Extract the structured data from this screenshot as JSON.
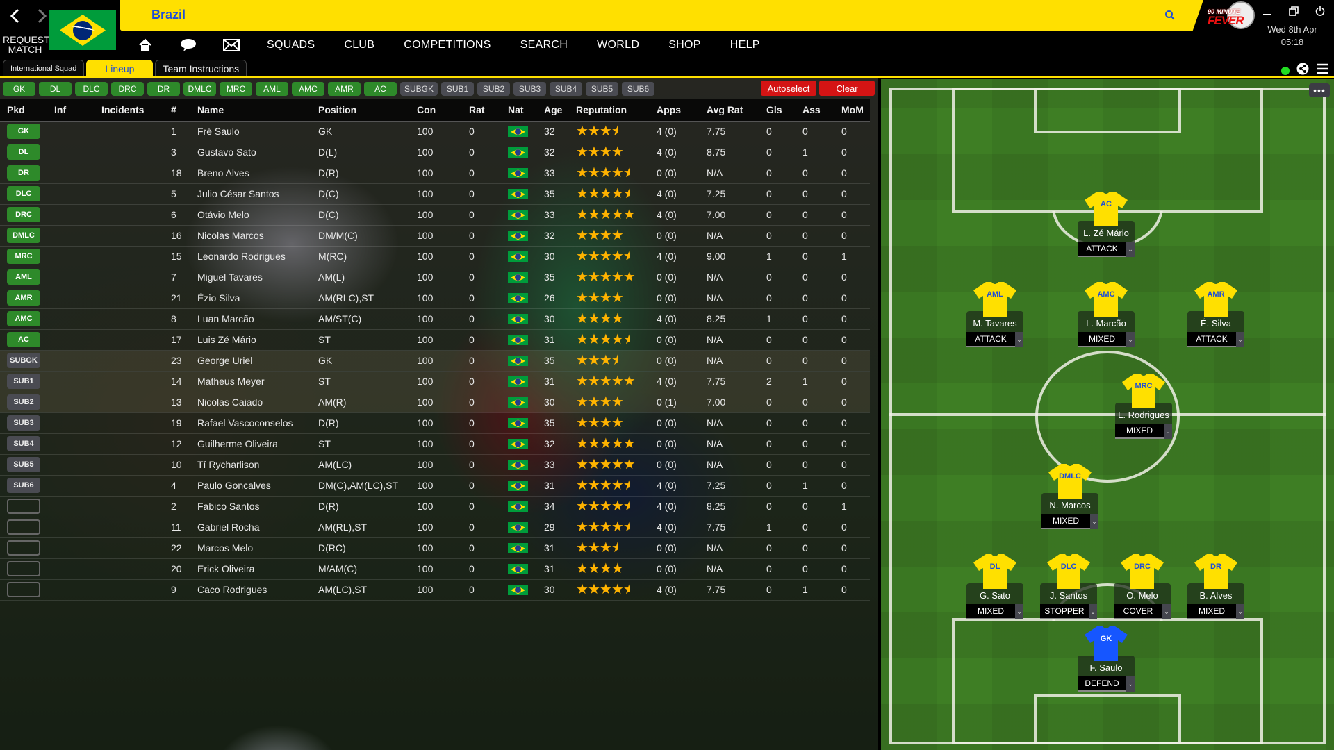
{
  "header": {
    "title": "Brazil",
    "request_match": "REQUEST MATCH",
    "date": "Wed 8th Apr",
    "time": "05:18",
    "logo_top": "90 MINUTE",
    "logo_bottom": "FEVER"
  },
  "menu": [
    "SQUADS",
    "CLUB",
    "COMPETITIONS",
    "SEARCH",
    "WORLD",
    "SHOP",
    "HELP"
  ],
  "tabs": [
    "International Squad",
    "Lineup",
    "Team Instructions"
  ],
  "active_tab": "Lineup",
  "position_buttons": [
    "GK",
    "DL",
    "DLC",
    "DRC",
    "DR",
    "DMLC",
    "MRC",
    "AML",
    "AMC",
    "AMR",
    "AC"
  ],
  "sub_buttons": [
    "SUBGK",
    "SUB1",
    "SUB2",
    "SUB3",
    "SUB4",
    "SUB5",
    "SUB6"
  ],
  "actions": {
    "autoselect": "Autoselect",
    "clear": "Clear"
  },
  "columns": [
    "Pkd",
    "Inf",
    "Incidents",
    "#",
    "Name",
    "Position",
    "Con",
    "Rat",
    "Nat",
    "Age",
    "Reputation",
    "Apps",
    "Avg Rat",
    "Gls",
    "Ass",
    "MoM"
  ],
  "players": [
    {
      "pkd": "GK",
      "num": "1",
      "name": "Fré Saulo",
      "pos": "GK",
      "con": "100",
      "rat": "0",
      "age": "32",
      "rep": 3.5,
      "apps": "4 (0)",
      "avg": "7.75",
      "gls": "0",
      "ass": "0",
      "mom": "0"
    },
    {
      "pkd": "DL",
      "num": "3",
      "name": "Gustavo Sato",
      "pos": "D(L)",
      "con": "100",
      "rat": "0",
      "age": "32",
      "rep": 4,
      "apps": "4 (0)",
      "avg": "8.75",
      "gls": "0",
      "ass": "1",
      "mom": "0"
    },
    {
      "pkd": "DR",
      "num": "18",
      "name": "Breno Alves",
      "pos": "D(R)",
      "con": "100",
      "rat": "0",
      "age": "33",
      "rep": 4.5,
      "apps": "0 (0)",
      "avg": "N/A",
      "gls": "0",
      "ass": "0",
      "mom": "0"
    },
    {
      "pkd": "DLC",
      "num": "5",
      "name": "Julio César Santos",
      "pos": "D(C)",
      "con": "100",
      "rat": "0",
      "age": "35",
      "rep": 4.5,
      "apps": "4 (0)",
      "avg": "7.25",
      "gls": "0",
      "ass": "0",
      "mom": "0"
    },
    {
      "pkd": "DRC",
      "num": "6",
      "name": "Otávio Melo",
      "pos": "D(C)",
      "con": "100",
      "rat": "0",
      "age": "33",
      "rep": 5,
      "apps": "4 (0)",
      "avg": "7.00",
      "gls": "0",
      "ass": "0",
      "mom": "0"
    },
    {
      "pkd": "DMLC",
      "num": "16",
      "name": "Nicolas Marcos",
      "pos": "DM/M(C)",
      "con": "100",
      "rat": "0",
      "age": "32",
      "rep": 4,
      "apps": "0 (0)",
      "avg": "N/A",
      "gls": "0",
      "ass": "0",
      "mom": "0"
    },
    {
      "pkd": "MRC",
      "num": "15",
      "name": "Leonardo Rodrigues",
      "pos": "M(RC)",
      "con": "100",
      "rat": "0",
      "age": "30",
      "rep": 4.5,
      "apps": "4 (0)",
      "avg": "9.00",
      "gls": "1",
      "ass": "0",
      "mom": "1"
    },
    {
      "pkd": "AML",
      "num": "7",
      "name": "Miguel Tavares",
      "pos": "AM(L)",
      "con": "100",
      "rat": "0",
      "age": "35",
      "rep": 5,
      "apps": "0 (0)",
      "avg": "N/A",
      "gls": "0",
      "ass": "0",
      "mom": "0"
    },
    {
      "pkd": "AMR",
      "num": "21",
      "name": "Ézio Silva",
      "pos": "AM(RLC),ST",
      "con": "100",
      "rat": "0",
      "age": "26",
      "rep": 4,
      "apps": "0 (0)",
      "avg": "N/A",
      "gls": "0",
      "ass": "0",
      "mom": "0"
    },
    {
      "pkd": "AMC",
      "num": "8",
      "name": "Luan Marcão",
      "pos": "AM/ST(C)",
      "con": "100",
      "rat": "0",
      "age": "30",
      "rep": 4,
      "apps": "4 (0)",
      "avg": "8.25",
      "gls": "1",
      "ass": "0",
      "mom": "0"
    },
    {
      "pkd": "AC",
      "num": "17",
      "name": "Luis Zé Mário",
      "pos": "ST",
      "con": "100",
      "rat": "0",
      "age": "31",
      "rep": 4.5,
      "apps": "0 (0)",
      "avg": "N/A",
      "gls": "0",
      "ass": "0",
      "mom": "0"
    },
    {
      "pkd": "SUBGK",
      "num": "23",
      "name": "George Uriel",
      "pos": "GK",
      "con": "100",
      "rat": "0",
      "age": "35",
      "rep": 3.5,
      "apps": "0 (0)",
      "avg": "N/A",
      "gls": "0",
      "ass": "0",
      "mom": "0"
    },
    {
      "pkd": "SUB1",
      "num": "14",
      "name": "Matheus Meyer",
      "pos": "ST",
      "con": "100",
      "rat": "0",
      "age": "31",
      "rep": 5,
      "apps": "4 (0)",
      "avg": "7.75",
      "gls": "2",
      "ass": "1",
      "mom": "0"
    },
    {
      "pkd": "SUB2",
      "num": "13",
      "name": "Nicolas Caiado",
      "pos": "AM(R)",
      "con": "100",
      "rat": "0",
      "age": "30",
      "rep": 4,
      "apps": "0 (1)",
      "avg": "7.00",
      "gls": "0",
      "ass": "0",
      "mom": "0"
    },
    {
      "pkd": "SUB3",
      "num": "19",
      "name": "Rafael Vascoconselos",
      "pos": "D(R)",
      "con": "100",
      "rat": "0",
      "age": "35",
      "rep": 4,
      "apps": "0 (0)",
      "avg": "N/A",
      "gls": "0",
      "ass": "0",
      "mom": "0"
    },
    {
      "pkd": "SUB4",
      "num": "12",
      "name": "Guilherme Oliveira",
      "pos": "ST",
      "con": "100",
      "rat": "0",
      "age": "32",
      "rep": 5,
      "apps": "0 (0)",
      "avg": "N/A",
      "gls": "0",
      "ass": "0",
      "mom": "0"
    },
    {
      "pkd": "SUB5",
      "num": "10",
      "name": "Tí Rycharlison",
      "pos": "AM(LC)",
      "con": "100",
      "rat": "0",
      "age": "33",
      "rep": 5,
      "apps": "0 (0)",
      "avg": "N/A",
      "gls": "0",
      "ass": "0",
      "mom": "0"
    },
    {
      "pkd": "SUB6",
      "num": "4",
      "name": "Paulo Goncalves",
      "pos": "DM(C),AM(LC),ST",
      "con": "100",
      "rat": "0",
      "age": "31",
      "rep": 4.5,
      "apps": "4 (0)",
      "avg": "7.25",
      "gls": "0",
      "ass": "1",
      "mom": "0"
    },
    {
      "pkd": "",
      "num": "2",
      "name": "Fabico Santos",
      "pos": "D(R)",
      "con": "100",
      "rat": "0",
      "age": "34",
      "rep": 4.5,
      "apps": "4 (0)",
      "avg": "8.25",
      "gls": "0",
      "ass": "0",
      "mom": "1"
    },
    {
      "pkd": "",
      "num": "11",
      "name": "Gabriel Rocha",
      "pos": "AM(RL),ST",
      "con": "100",
      "rat": "0",
      "age": "29",
      "rep": 4.5,
      "apps": "4 (0)",
      "avg": "7.75",
      "gls": "1",
      "ass": "0",
      "mom": "0"
    },
    {
      "pkd": "",
      "num": "22",
      "name": "Marcos Melo",
      "pos": "D(RC)",
      "con": "100",
      "rat": "0",
      "age": "31",
      "rep": 3.5,
      "apps": "0 (0)",
      "avg": "N/A",
      "gls": "0",
      "ass": "0",
      "mom": "0"
    },
    {
      "pkd": "",
      "num": "20",
      "name": "Erick Oliveira",
      "pos": "M/AM(C)",
      "con": "100",
      "rat": "0",
      "age": "31",
      "rep": 4,
      "apps": "0 (0)",
      "avg": "N/A",
      "gls": "0",
      "ass": "0",
      "mom": "0"
    },
    {
      "pkd": "",
      "num": "9",
      "name": "Caco Rodrigues",
      "pos": "AM(LC),ST",
      "con": "100",
      "rat": "0",
      "age": "30",
      "rep": 4.5,
      "apps": "4 (0)",
      "avg": "7.75",
      "gls": "0",
      "ass": "1",
      "mom": "0"
    }
  ],
  "formation": [
    {
      "pos": "AC",
      "name": "L. Zé Mário",
      "role": "ATTACK"
    },
    {
      "pos": "AML",
      "name": "M. Tavares",
      "role": "ATTACK"
    },
    {
      "pos": "AMC",
      "name": "L. Marcão",
      "role": "MIXED"
    },
    {
      "pos": "AMR",
      "name": "É. Silva",
      "role": "ATTACK"
    },
    {
      "pos": "MRC",
      "name": "L. Rodrigues",
      "role": "MIXED"
    },
    {
      "pos": "DMLC",
      "name": "N. Marcos",
      "role": "MIXED"
    },
    {
      "pos": "DL",
      "name": "G. Sato",
      "role": "MIXED"
    },
    {
      "pos": "DLC",
      "name": "J. Santos",
      "role": "STOPPER"
    },
    {
      "pos": "DRC",
      "name": "O. Melo",
      "role": "COVER"
    },
    {
      "pos": "DR",
      "name": "B. Alves",
      "role": "MIXED"
    },
    {
      "pos": "GK",
      "name": "F. Saulo",
      "role": "DEFEND"
    }
  ],
  "colors": {
    "brand_yellow": "#ffe000",
    "title_blue": "#1d4ed8",
    "pos_green": "#2e8a2a",
    "sub_grey": "#4a4b52",
    "action_red": "#d41414",
    "gk_blue": "#1656ff",
    "con_green": "#22dd22"
  },
  "icons": {
    "back": "chevron-left-icon",
    "forward": "chevron-right-icon",
    "home": "home-icon",
    "chat": "chat-bubble-icon",
    "mail": "envelope-icon",
    "search": "search-icon",
    "minimize": "minimize-icon",
    "restore": "restore-icon",
    "power": "power-icon",
    "online": "status-dot-icon",
    "share": "share-icon",
    "menu": "hamburger-icon",
    "more": "more-dots-icon"
  }
}
